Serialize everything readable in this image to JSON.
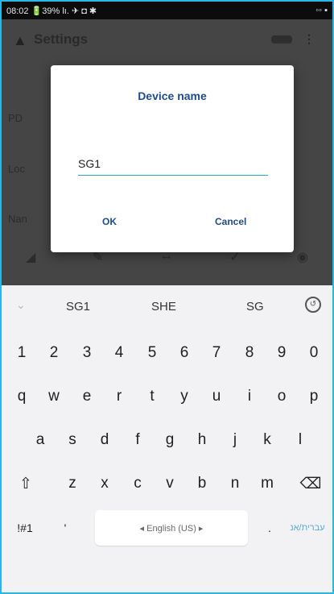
{
  "status_bar": {
    "time": "08:02",
    "battery": "39%",
    "left_text": "08:02 🔋39% lı. ✈ ◘ ✱",
    "right_text": "◦◦ ▪"
  },
  "app": {
    "title": "Settings",
    "rows": [
      "PD",
      "Loc",
      "Nan"
    ],
    "bottom_icons": [
      "◢",
      "✎",
      "↔",
      "✓",
      "◉"
    ]
  },
  "dialog": {
    "title": "Device name",
    "input_value": "SG1",
    "ok_label": "OK",
    "cancel_label": "Cancel"
  },
  "keyboard": {
    "suggestions": [
      "SG1",
      "SHE",
      "SG"
    ],
    "number_row": [
      "1",
      "2",
      "3",
      "4",
      "5",
      "6",
      "7",
      "8",
      "9",
      "0"
    ],
    "row1": [
      "q",
      "w",
      "e",
      "r",
      "t",
      "y",
      "u",
      "i",
      "o",
      "p"
    ],
    "row2": [
      "a",
      "s",
      "d",
      "f",
      "g",
      "h",
      "j",
      "k",
      "l"
    ],
    "row3": [
      "z",
      "x",
      "c",
      "v",
      "b",
      "n",
      "m"
    ],
    "shift_glyph": "⇧",
    "backspace_glyph": "⌫",
    "symbols_label": "!#1",
    "apostrophe": "'",
    "space_label": "◂ English (US) ▸",
    "period": ".",
    "lang_label": "עברית/אנ"
  }
}
